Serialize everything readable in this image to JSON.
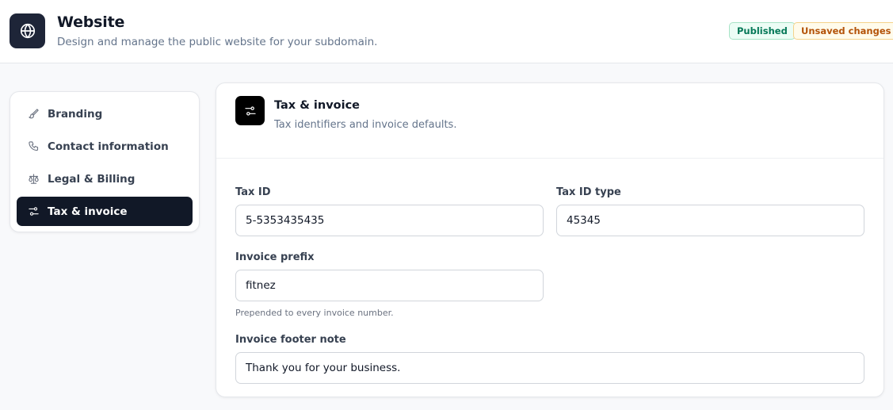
{
  "header": {
    "title": "Website",
    "subtitle": "Design and manage the public website for your subdomain.",
    "icon": "globe-icon",
    "badges": {
      "published": "Published",
      "unsaved": "Unsaved changes"
    }
  },
  "sidebar": {
    "items": [
      {
        "label": "Branding",
        "icon": "paintbrush-icon",
        "active": false
      },
      {
        "label": "Contact information",
        "icon": "phone-icon",
        "active": false
      },
      {
        "label": "Legal & Billing",
        "icon": "scale-icon",
        "active": false
      },
      {
        "label": "Tax & invoice",
        "icon": "sliders-icon",
        "active": true
      }
    ]
  },
  "section": {
    "title": "Tax & invoice",
    "subtitle": "Tax identifiers and invoice defaults.",
    "icon": "sliders-icon",
    "fields": {
      "tax_id": {
        "label": "Tax ID",
        "value": "5-5353435435"
      },
      "tax_id_type": {
        "label": "Tax ID type",
        "value": "45345"
      },
      "invoice_prefix": {
        "label": "Invoice prefix",
        "value": "fitnez",
        "hint": "Prepended to every invoice number."
      },
      "invoice_footer": {
        "label": "Invoice footer note",
        "value": "Thank you for your business."
      }
    }
  },
  "colors": {
    "accent_dark": "#111827",
    "published_green": "#047857",
    "unsaved_amber": "#b45309"
  }
}
